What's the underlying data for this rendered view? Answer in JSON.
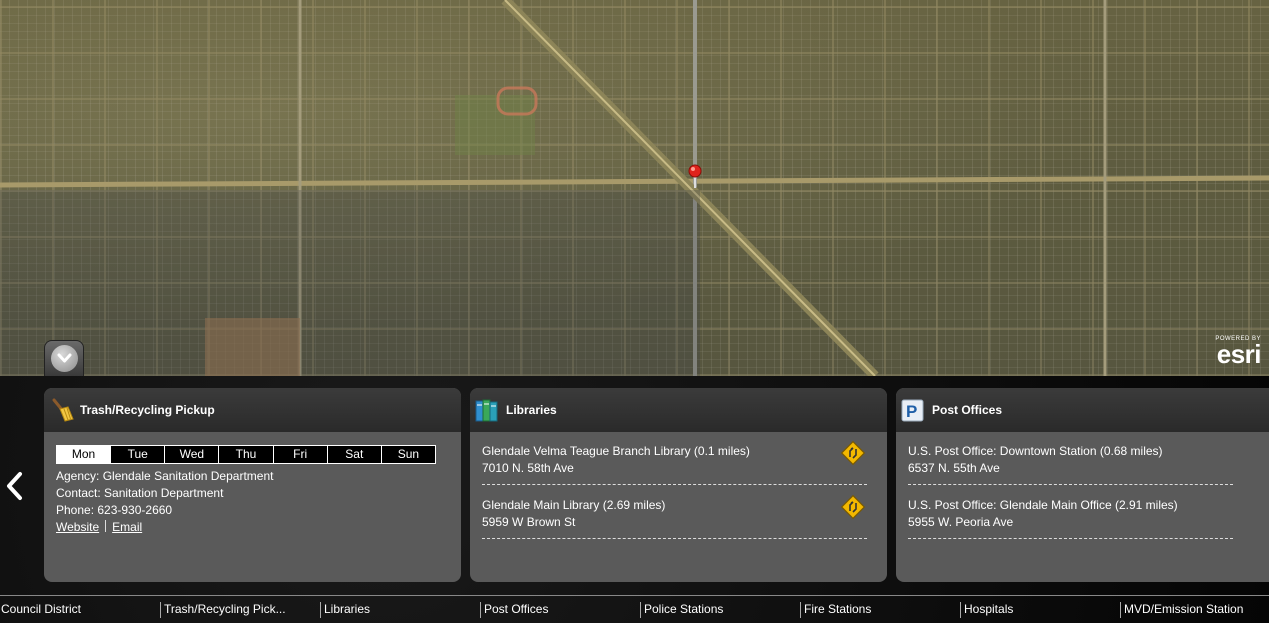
{
  "map": {
    "esri_powered": "POWERED BY",
    "esri_name": "esri",
    "marker_icon": "map-pin-icon"
  },
  "colors": {
    "panel_bg": "#000000",
    "card_bg": "#5a5a5a",
    "card_header_bg": "#2f2f2f",
    "marker": "#e0231c",
    "direction_sign": "#f3b800"
  },
  "cards": {
    "trash": {
      "title": "Trash/Recycling Pickup",
      "icon": "broom-icon",
      "days": [
        "Mon",
        "Tue",
        "Wed",
        "Thu",
        "Fri",
        "Sat",
        "Sun"
      ],
      "selected_day": "Mon",
      "agency": "Agency: Glendale Sanitation Department",
      "contact": "Contact: Sanitation Department",
      "phone": "Phone: 623-930-2660",
      "website_label": "Website",
      "email_label": "Email"
    },
    "libraries": {
      "title": "Libraries",
      "icon": "books-icon",
      "items": [
        {
          "name": "Glendale Velma Teague Branch Library (0.1 miles)",
          "address": "7010 N. 58th Ave"
        },
        {
          "name": "Glendale Main Library (2.69 miles)",
          "address": "5959 W Brown St"
        }
      ]
    },
    "post": {
      "title": "Post Offices",
      "icon": "post-office-icon",
      "items": [
        {
          "name": "U.S. Post Office: Downtown Station (0.68 miles)",
          "address": "6537 N. 55th Ave"
        },
        {
          "name": "U.S. Post Office: Glendale Main Office (2.91 miles)",
          "address": "5955 W. Peoria Ave"
        }
      ]
    }
  },
  "tabs": [
    {
      "label": "Council District"
    },
    {
      "label": "Trash/Recycling Pick..."
    },
    {
      "label": "Libraries"
    },
    {
      "label": "Post Offices"
    },
    {
      "label": "Police Stations"
    },
    {
      "label": "Fire Stations"
    },
    {
      "label": "Hospitals"
    },
    {
      "label": "MVD/Emission Station"
    }
  ]
}
